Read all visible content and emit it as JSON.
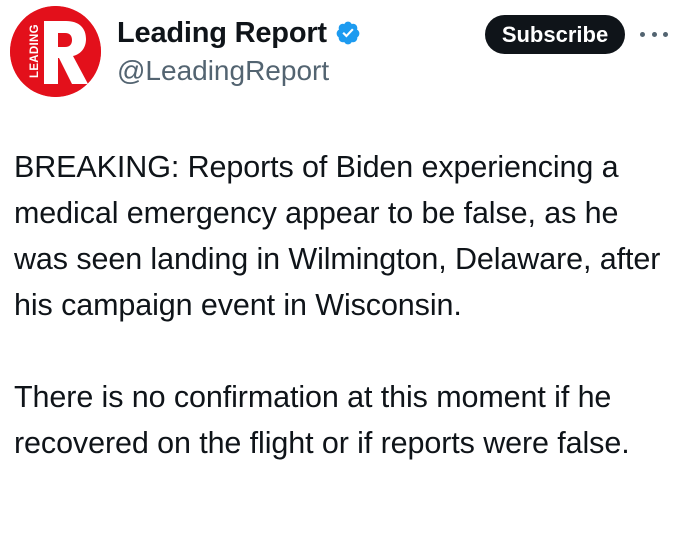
{
  "account": {
    "display_name": "Leading Report",
    "handle": "@LeadingReport",
    "verified": true,
    "avatar": {
      "letter": "R",
      "text": "LEADING",
      "background_color": "#e3101b"
    }
  },
  "actions": {
    "subscribe_label": "Subscribe",
    "more_icon": "more-horizontal-icon"
  },
  "tweet": {
    "paragraphs": [
      "BREAKING: Reports of Biden experiencing a medical emergency appear to be false, as he was seen landing in Wilmington, Delaware, after his campaign event in Wisconsin.",
      "There is no confirmation at this moment if he recovered on the flight or if reports were false."
    ]
  },
  "colors": {
    "text": "#0f1419",
    "secondary_text": "#536471",
    "verified_badge": "#1d9bf0",
    "button_background": "#0f1419"
  }
}
